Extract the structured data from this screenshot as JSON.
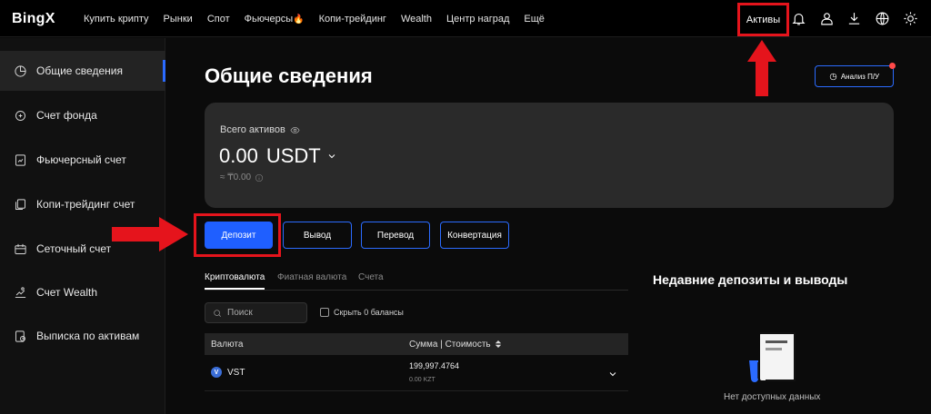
{
  "brand": "BingX",
  "nav": {
    "items": [
      "Купить крипту",
      "Рынки",
      "Спот",
      "Фьючерсы",
      "Копи-трейдинг",
      "Wealth",
      "Центр наград",
      "Ещё"
    ],
    "fire_glyph": "🔥",
    "assets_label": "Активы",
    "icons": [
      "bell-icon",
      "user-icon",
      "download-icon",
      "globe-icon",
      "sun-icon"
    ]
  },
  "sidebar": {
    "items": [
      {
        "label": "Общие сведения",
        "icon": "pie-chart-icon",
        "active": true
      },
      {
        "label": "Счет фонда",
        "icon": "fund-icon"
      },
      {
        "label": "Фьючерсный счет",
        "icon": "futures-icon"
      },
      {
        "label": "Копи-трейдинг счет",
        "icon": "copy-trading-icon"
      },
      {
        "label": "Сеточный счет",
        "icon": "grid-icon"
      },
      {
        "label": "Счет Wealth",
        "icon": "wealth-icon"
      },
      {
        "label": "Выписка по активам",
        "icon": "statement-icon"
      }
    ]
  },
  "main": {
    "title": "Общие сведения",
    "pnl_button": "Анализ П/У",
    "total_label": "Всего активов",
    "total_amount": "0.00",
    "total_currency": "USDT",
    "approx_value": "≈ ₸0.00",
    "actions": {
      "deposit": "Депозит",
      "withdraw": "Вывод",
      "transfer": "Перевод",
      "convert": "Конвертация"
    },
    "tabs": [
      "Криптовалюта",
      "Фиатная валюта",
      "Счета"
    ],
    "search_placeholder": "Поиск",
    "hide_zero_label": "Скрыть 0 балансы",
    "table": {
      "col_currency": "Валюта",
      "col_amount": "Сумма | Стоимость",
      "rows": [
        {
          "symbol": "VST",
          "icon_letter": "V",
          "amount": "199,997.4764",
          "value": "0.00 KZT"
        }
      ]
    },
    "recent_title": "Недавние депозиты и выводы",
    "empty_text": "Нет доступных данных"
  },
  "colors": {
    "accent": "#1f5fff",
    "annotation": "#e5141c",
    "card": "#2a2a2a"
  }
}
